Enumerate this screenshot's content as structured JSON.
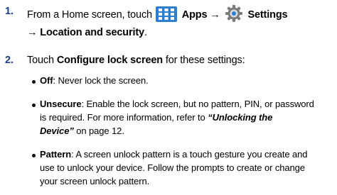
{
  "step1": {
    "number": "1.",
    "part1": "From a Home screen, touch",
    "apps_label": "Apps",
    "arrow1": "→",
    "settings_label": "Settings",
    "arrow2": "→",
    "location_label": "Location and security",
    "period": "."
  },
  "step2": {
    "number": "2.",
    "part1": "Touch",
    "configure_label": "Configure lock screen",
    "part2": "for these settings:"
  },
  "bullets": {
    "off": {
      "term": "Off",
      "text": ": Never lock the screen."
    },
    "unsecure": {
      "term": "Unsecure",
      "line1": ": Enable the lock screen, but no pattern, PIN, or password",
      "line2_a": "is required. For more information, refer to",
      "ref_a": "“Unlocking the",
      "ref_b": "Device”",
      "line3_b": "on page 12."
    },
    "pattern": {
      "term": "Pattern",
      "line1": ": A screen unlock pattern is a touch gesture you create and",
      "line2": "use to unlock your device. Follow the prompts to create or change",
      "line3": "your screen unlock pattern."
    }
  },
  "icons": {
    "apps": "apps-grid-icon",
    "settings": "settings-gear-icon"
  },
  "colors": {
    "step_number": "#1a3f82",
    "apps_icon_bg": "#2a7fd4",
    "gear": "#7a7a7a"
  }
}
